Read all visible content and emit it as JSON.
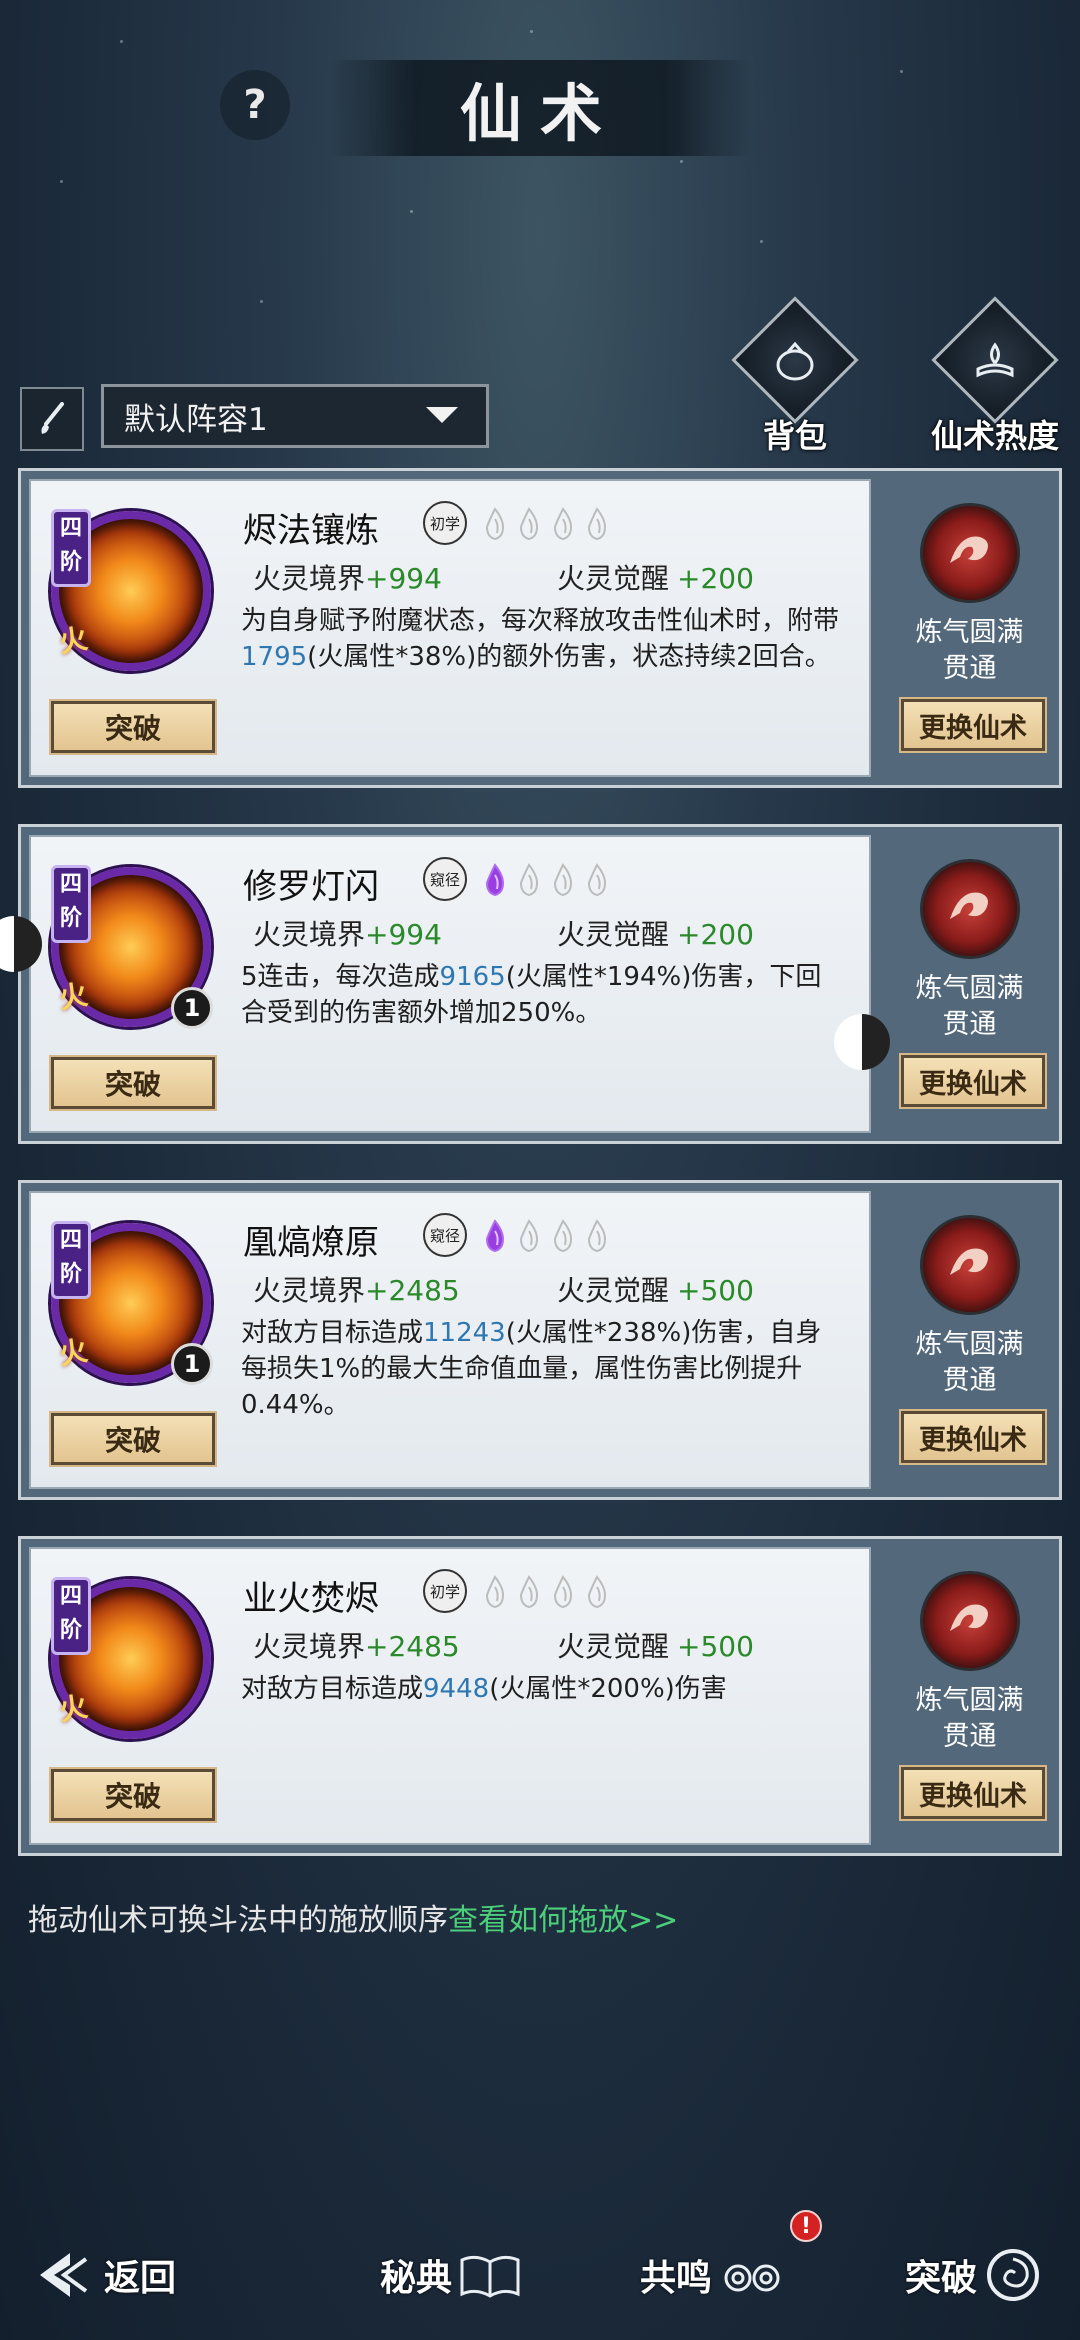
{
  "header": {
    "title": "仙术",
    "help_icon": "question-mark-icon"
  },
  "lineup": {
    "selected": "默认阵容1"
  },
  "corner_buttons": {
    "bag_label": "背包",
    "popularity_label": "仙术热度"
  },
  "cards": [
    {
      "tier": "四阶",
      "element": "火",
      "name": "烬法镶炼",
      "grade": "初学",
      "lit_flames": 0,
      "total_flames": 4,
      "stat1_label": "火灵境界",
      "stat1_value": "+994",
      "stat2_label": "火灵觉醒",
      "stat2_value": "+200",
      "desc_pre": "为自身赋予附魔状态，每次释放攻击性仙术时，附带",
      "desc_num": "1795",
      "desc_post": "(火属性*38%)的额外伤害，状态持续2回合。",
      "count": "",
      "breakthrough": "突破",
      "side_status_1": "炼气圆满",
      "side_status_2": "贯通",
      "change_label": "更换仙术"
    },
    {
      "tier": "四阶",
      "element": "火",
      "name": "修罗灯闪",
      "grade": "窥径",
      "lit_flames": 1,
      "total_flames": 4,
      "stat1_label": "火灵境界",
      "stat1_value": "+994",
      "stat2_label": "火灵觉醒",
      "stat2_value": "+200",
      "desc_pre": "5连击，每次造成",
      "desc_num": "9165",
      "desc_post": "(火属性*194%)伤害，下回合受到的伤害额外增加250%。",
      "count": "1",
      "breakthrough": "突破",
      "side_status_1": "炼气圆满",
      "side_status_2": "贯通",
      "change_label": "更换仙术"
    },
    {
      "tier": "四阶",
      "element": "火",
      "name": "凰熇燎原",
      "grade": "窥径",
      "lit_flames": 1,
      "total_flames": 4,
      "stat1_label": "火灵境界",
      "stat1_value": "+2485",
      "stat2_label": "火灵觉醒",
      "stat2_value": "+500",
      "desc_pre": "对敌方目标造成",
      "desc_num": "11243",
      "desc_post": "(火属性*238%)伤害，自身每损失1%的最大生命值血量，属性伤害比例提升0.44%。",
      "count": "1",
      "breakthrough": "突破",
      "side_status_1": "炼气圆满",
      "side_status_2": "贯通",
      "change_label": "更换仙术"
    },
    {
      "tier": "四阶",
      "element": "火",
      "name": "业火焚烬",
      "grade": "初学",
      "lit_flames": 0,
      "total_flames": 4,
      "stat1_label": "火灵境界",
      "stat1_value": "+2485",
      "stat2_label": "火灵觉醒",
      "stat2_value": "+500",
      "desc_pre": "对敌方目标造成",
      "desc_num": "9448",
      "desc_post": "(火属性*200%)伤害",
      "count": "",
      "breakthrough": "突破",
      "side_status_1": "炼气圆满",
      "side_status_2": "贯通",
      "change_label": "更换仙术"
    }
  ],
  "hint": {
    "text": "拖动仙术可换斗法中的施放顺序",
    "link": "查看如何拖放>>"
  },
  "bottom_nav": {
    "back": "返回",
    "secret_book": "秘典",
    "resonance": "共鸣",
    "breakthrough": "突破",
    "notification": "!"
  },
  "colors": {
    "stat_value": "#2a8a2a",
    "damage_number": "#2e77b0",
    "link": "#4ccf7a",
    "tier_badge": "#4a2285"
  }
}
